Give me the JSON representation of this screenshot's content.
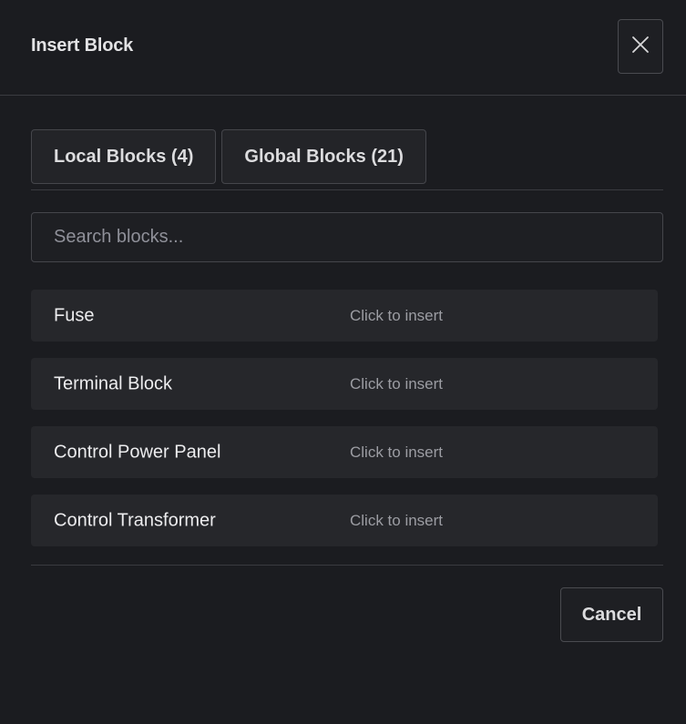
{
  "dialog": {
    "title": "Insert Block",
    "close_icon": "close-icon"
  },
  "tabs": [
    {
      "label": "Local Blocks (4)"
    },
    {
      "label": "Global Blocks (21)"
    }
  ],
  "search": {
    "placeholder": "Search blocks...",
    "value": ""
  },
  "blocks": [
    {
      "name": "Fuse",
      "hint": "Click to insert"
    },
    {
      "name": "Terminal Block",
      "hint": "Click to insert"
    },
    {
      "name": "Control Power Panel",
      "hint": "Click to insert"
    },
    {
      "name": "Control Transformer",
      "hint": "Click to insert"
    }
  ],
  "footer": {
    "cancel_label": "Cancel"
  },
  "colors": {
    "background": "#1b1c20",
    "item_background": "#26272b",
    "border": "#45464b",
    "text": "#ececee",
    "muted_text": "#9c9da3"
  }
}
